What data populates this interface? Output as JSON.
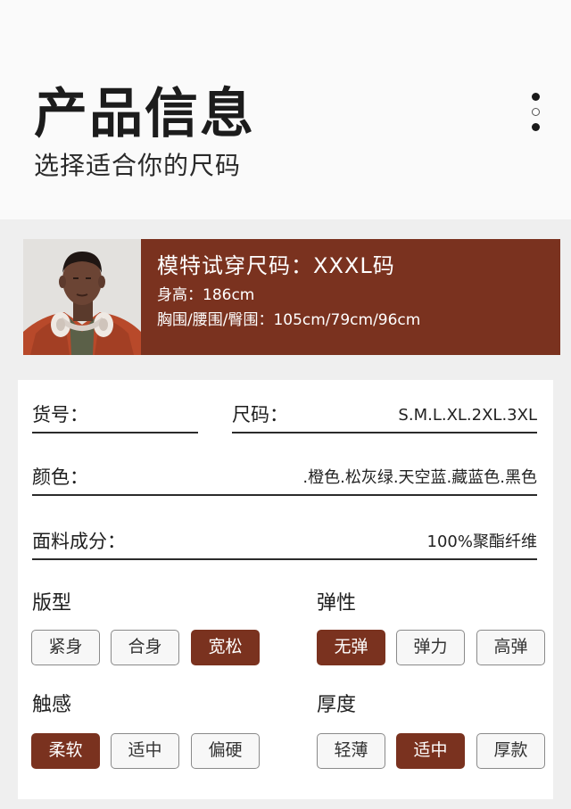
{
  "header": {
    "title": "产品信息",
    "subtitle": "选择适合你的尺码"
  },
  "model": {
    "title": "模特试穿尺码：XXXL码",
    "height": "身高：186cm",
    "measurements": "胸围/腰围/臀围：105cm/79cm/96cm",
    "photo_icon": "model-photo"
  },
  "fields": {
    "item_no": {
      "label": "货号：",
      "value": ""
    },
    "size": {
      "label": "尺码：",
      "value": "S.M.L.XL.2XL.3XL"
    },
    "color": {
      "label": "颜色：",
      "value": ".橙色.松灰绿.天空蓝.藏蓝色.黑色"
    },
    "fabric": {
      "label": "面料成分：",
      "value": "100%聚酯纤维"
    }
  },
  "fit": {
    "title": "版型",
    "options": [
      "紧身",
      "合身",
      "宽松"
    ],
    "selected": "宽松"
  },
  "elasticity": {
    "title": "弹性",
    "options": [
      "无弹",
      "弹力",
      "高弹"
    ],
    "selected": "无弹"
  },
  "touch": {
    "title": "触感",
    "options": [
      "柔软",
      "适中",
      "偏硬"
    ],
    "selected": "柔软"
  },
  "thickness": {
    "title": "厚度",
    "options": [
      "轻薄",
      "适中",
      "厚款"
    ],
    "selected": "适中"
  },
  "colors": {
    "accent": "#7a321f",
    "text": "#222222",
    "background": "#efefef"
  }
}
